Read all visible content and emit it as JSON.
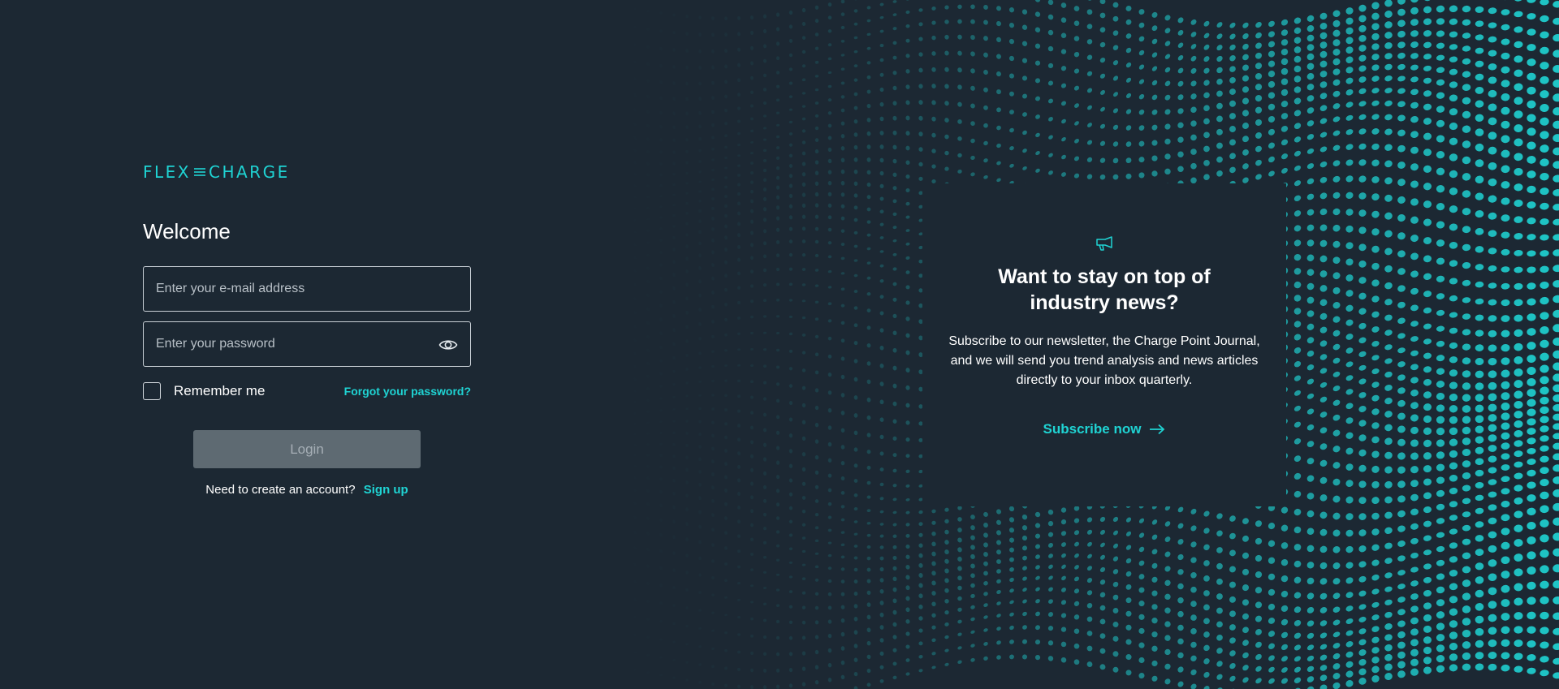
{
  "brand": {
    "logo_left": "FLEX",
    "logo_right": "CHARGE",
    "accent_color": "#1fd3d3",
    "background_color": "#1c2833"
  },
  "login": {
    "title": "Welcome",
    "email_placeholder": "Enter your e-mail address",
    "password_placeholder": "Enter your password",
    "password_toggle_icon": "eye-icon",
    "remember_label": "Remember me",
    "forgot_label": "Forgot your password?",
    "login_button": "Login",
    "login_button_state": "disabled",
    "signup_prompt": "Need to create an account?",
    "signup_link": "Sign up"
  },
  "newsletter": {
    "icon": "megaphone-icon",
    "title": "Want to stay on top of industry news?",
    "body": "Subscribe to our newsletter, the Charge Point Journal, and we will send you trend analysis and news articles directly to your inbox quarterly.",
    "cta": "Subscribe now",
    "cta_icon": "arrow-right-icon"
  }
}
